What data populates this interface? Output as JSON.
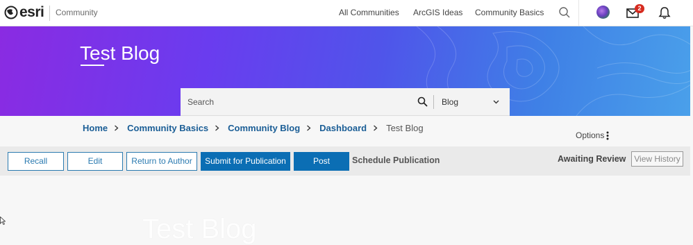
{
  "header": {
    "logo_text": "esri",
    "section": "Community",
    "nav": [
      "All Communities",
      "ArcGIS Ideas",
      "Community Basics"
    ],
    "mail_count": "2"
  },
  "hero": {
    "title": "Test Blog"
  },
  "search": {
    "placeholder": "Search",
    "scope": "Blog"
  },
  "breadcrumb": {
    "items": [
      "Home",
      "Community Basics",
      "Community Blog",
      "Dashboard"
    ],
    "current": "Test Blog"
  },
  "options_label": "Options",
  "actions": {
    "recall": "Recall",
    "edit": "Edit",
    "return_to_author": "Return to Author",
    "submit": "Submit for Publication",
    "post": "Post",
    "schedule": "Schedule Publication",
    "status": "Awaiting Review",
    "view_history": "View History"
  },
  "article": {
    "title": "Test Blog"
  },
  "colors": {
    "brand_blue": "#0b6eb4",
    "link_blue": "#1b5e96",
    "badge_red": "#d62b1f"
  }
}
